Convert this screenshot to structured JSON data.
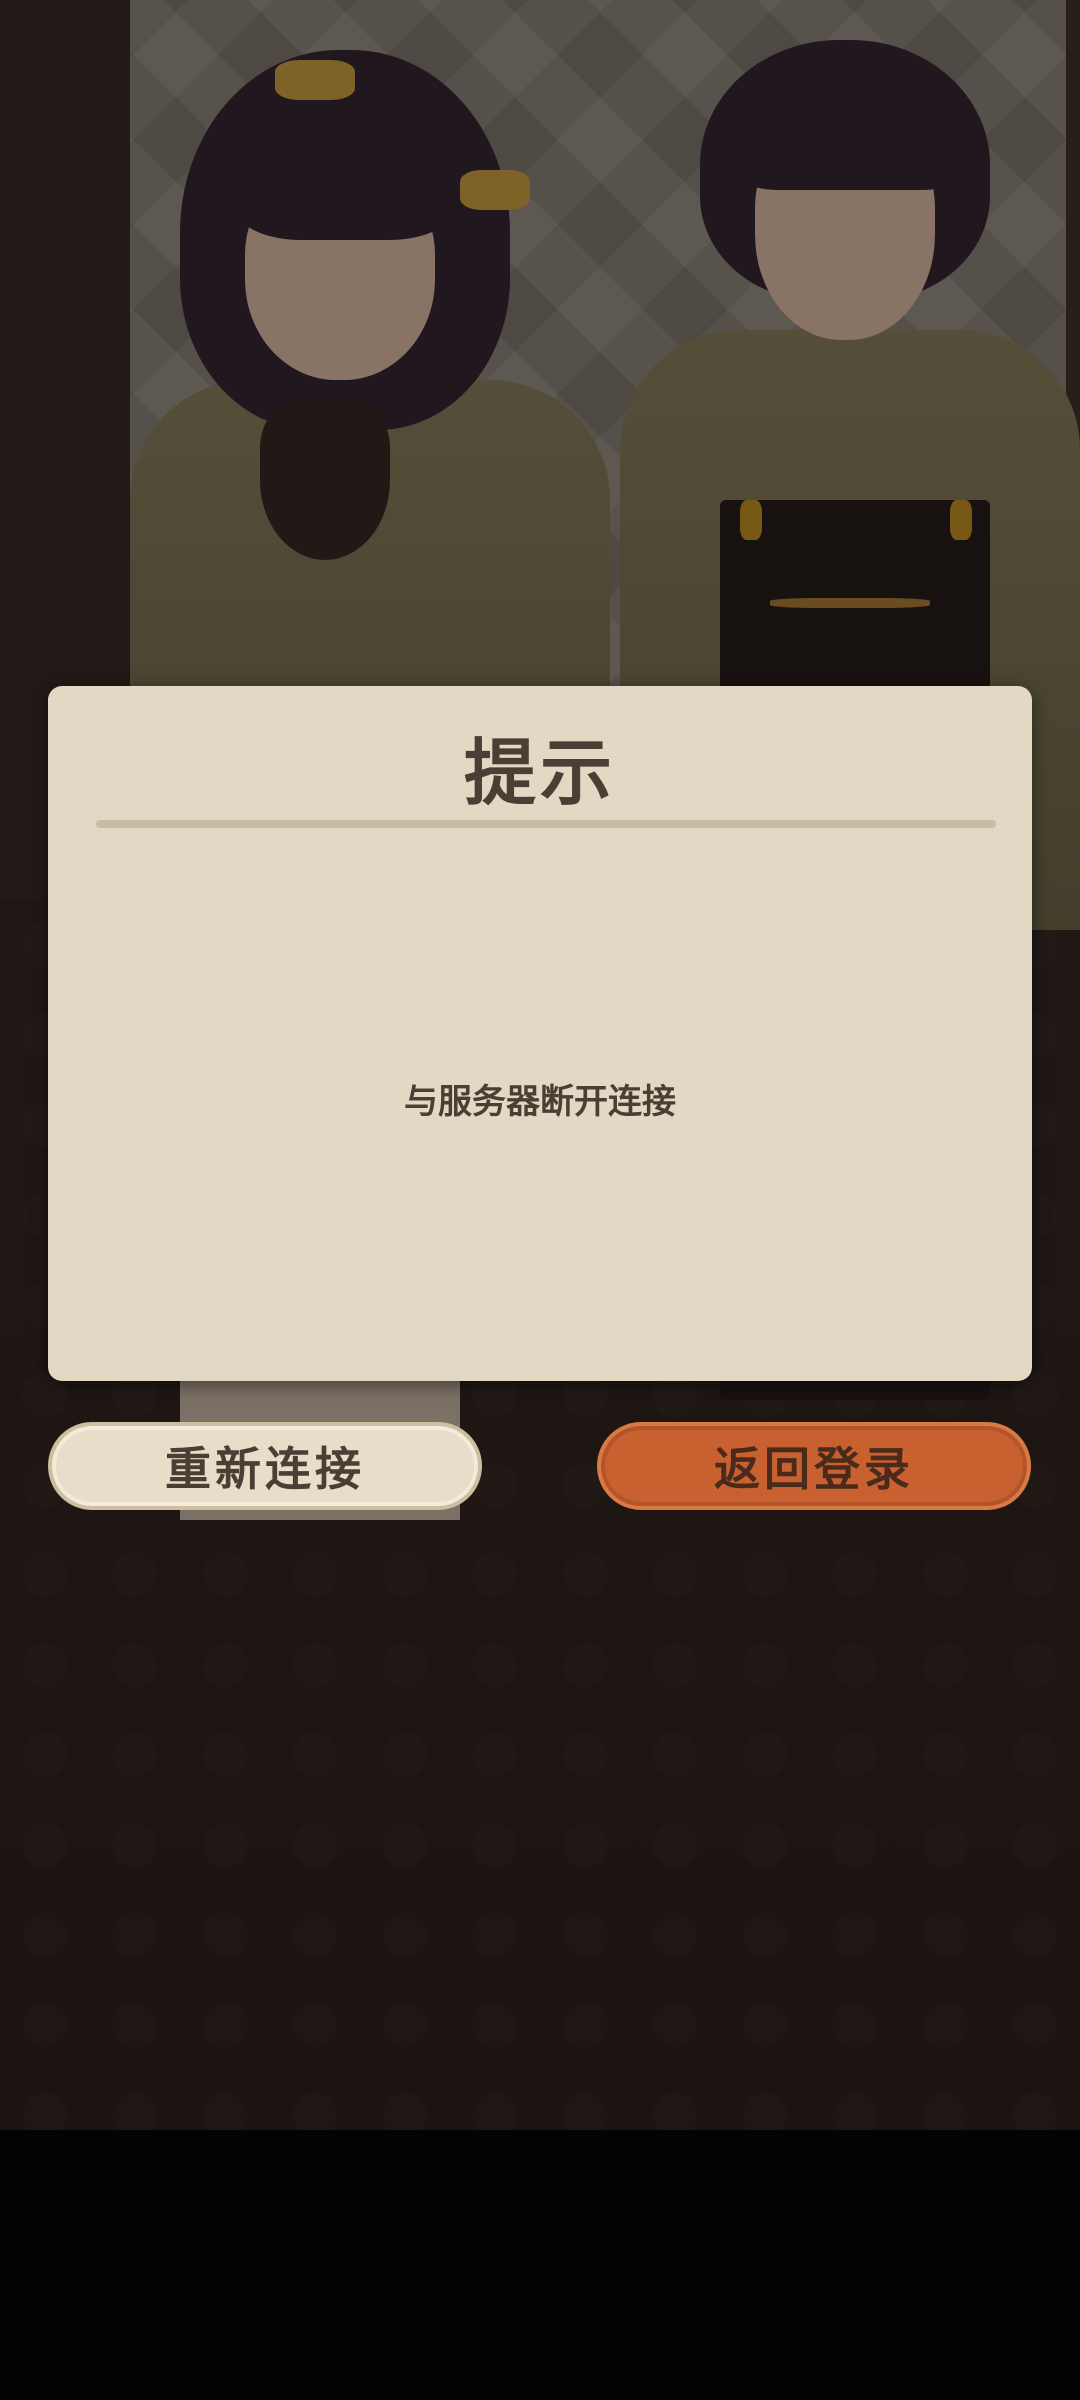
{
  "dialog": {
    "title": "提示",
    "message": "与服务器断开连接"
  },
  "buttons": {
    "reconnect_label": "重新连接",
    "return_login_label": "返回登录"
  },
  "colors": {
    "dialog_background": "#e3d8c3",
    "text": "#4a3f35",
    "primary_button": "#c8612f",
    "secondary_button": "#e8ddc8"
  }
}
